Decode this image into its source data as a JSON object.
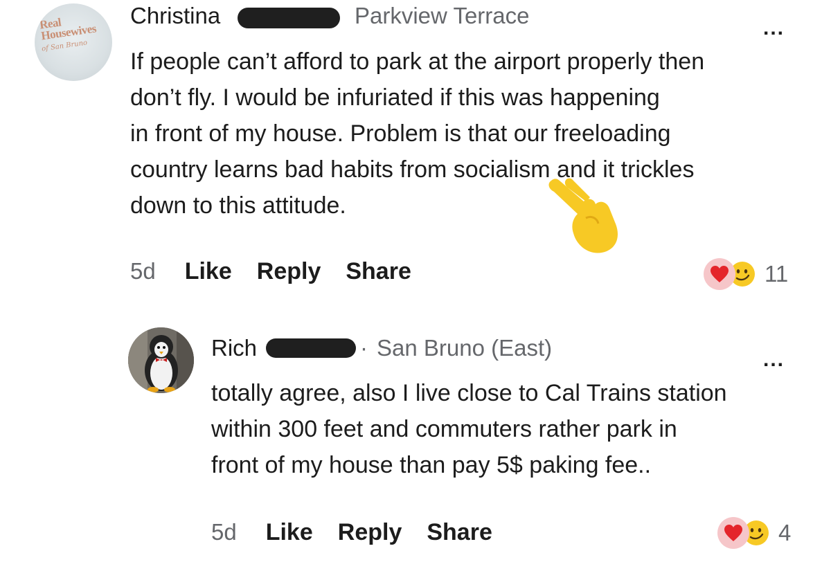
{
  "comments": [
    {
      "author": "Christina",
      "location": "Parkview Terrace",
      "more_label": "...",
      "body_lines": [
        "If people can’t afford to park at the airport properly then",
        "don’t fly. I would be infuriated if this was happening",
        "in front of my house. Problem is that our freeloading",
        "country learns bad habits from socialism and it trickles",
        "down to this attitude."
      ],
      "time": "5d",
      "actions": [
        "Like",
        "Reply",
        "Share"
      ],
      "reaction_count": "11",
      "avatar_logo": [
        "Real",
        "Housewives",
        "of San Bruno"
      ]
    },
    {
      "author": "Rich",
      "location_separator": "·",
      "location": "San Bruno (East)",
      "more_label": "...",
      "body_lines": [
        "totally agree, also I live close to Cal Trains station",
        "within 300 feet   and commuters rather park in",
        "front of my house than pay 5$ paking fee.."
      ],
      "time": "5d",
      "actions": [
        "Like",
        "Reply",
        "Share"
      ],
      "reaction_count": "4"
    }
  ],
  "icons": {
    "reaction_1": "heart-icon",
    "reaction_2": "smirk-face-icon",
    "overlay": "pointing-hand-emoji"
  },
  "colors": {
    "text": "#1c1c1c",
    "muted": "#65676b",
    "heart": "#e4252b",
    "heart_bg": "#f6c6c9",
    "emoji_yellow": "#f7c925"
  }
}
